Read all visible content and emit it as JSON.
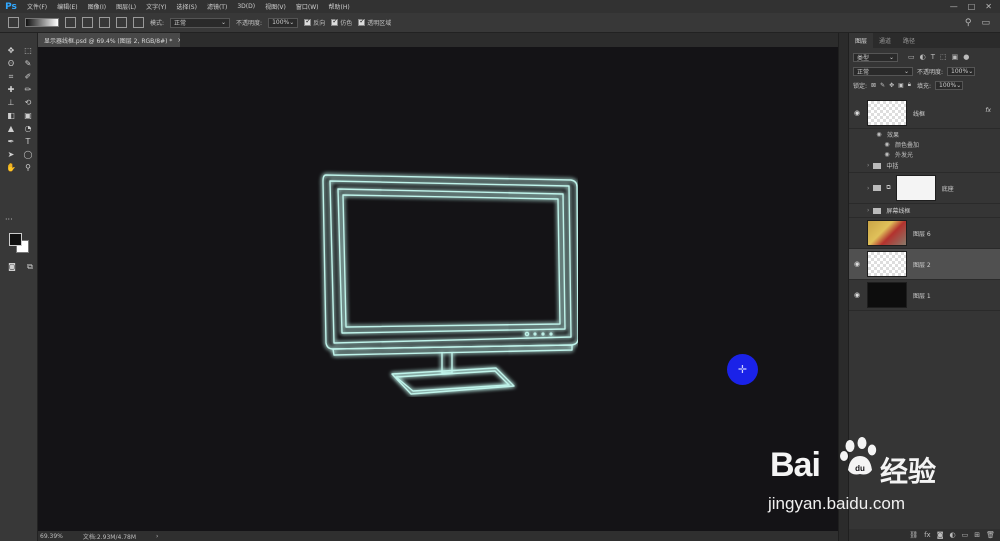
{
  "app": {
    "logo": "Ps",
    "menu": [
      "文件(F)",
      "编辑(E)",
      "图像(I)",
      "图层(L)",
      "文字(Y)",
      "选择(S)",
      "滤镜(T)",
      "3D(D)",
      "视图(V)",
      "窗口(W)",
      "帮助(H)"
    ],
    "window_controls": [
      "—",
      "□",
      "✕"
    ]
  },
  "options_bar": {
    "mode_label": "模式:",
    "mode_value": "正常",
    "opacity_label": "不透明度:",
    "opacity_value": "100%",
    "checkboxes": [
      "反向",
      "仿色",
      "透明区域"
    ]
  },
  "tools": {
    "icons": [
      "move-tool",
      "marquee-tool",
      "lasso-tool",
      "magic-wand-tool",
      "crop-tool",
      "eyedropper-tool",
      "healing-tool",
      "brush-tool",
      "stamp-tool",
      "history-brush-tool",
      "eraser-tool",
      "gradient-tool",
      "blur-tool",
      "dodge-tool",
      "pen-tool",
      "type-tool",
      "path-select-tool",
      "shape-tool",
      "hand-tool",
      "zoom-tool"
    ],
    "glyphs": [
      "✥",
      "⬚",
      "ʘ",
      "✎",
      "⌗",
      "✐",
      "✚",
      "✏",
      "⊥",
      "⟲",
      "◧",
      "▣",
      "▲",
      "◔",
      "✒",
      "T",
      "➤",
      "◯",
      "✋",
      "⚲"
    ],
    "extra": "···",
    "foreground_color": "#111111",
    "background_color": "#ffffff"
  },
  "document": {
    "tab_title": "显示器线框.psd @ 69.4% (图层 2, RGB/8#) *",
    "close": "×"
  },
  "status": {
    "zoom": "69.39%",
    "doc_info": "文档:2.93M/4.78M",
    "arrow": "›"
  },
  "layers_panel": {
    "tabs": [
      "图层",
      "通道",
      "路径"
    ],
    "filter_label": "类型",
    "blend_mode": "正常",
    "opacity_label": "不透明度:",
    "opacity_value": "100%",
    "lock_label": "锁定:",
    "fill_label": "填充:",
    "fill_value": "100%",
    "layers": [
      {
        "name": "线框",
        "thumb": "checker",
        "visible": true,
        "fx": "fx"
      },
      {
        "name": "中括",
        "type": "group"
      },
      {
        "name": "底座",
        "thumb": "white",
        "visible": false
      },
      {
        "name": "屏幕线框",
        "type": "group"
      },
      {
        "name": "图层 6",
        "thumb": "photo",
        "visible": false
      },
      {
        "name": "图层 2",
        "thumb": "checker",
        "visible": true,
        "selected": true
      },
      {
        "name": "图层 1",
        "thumb": "black",
        "visible": true
      }
    ],
    "effects_label": "效果",
    "effects": [
      "颜色叠加",
      "外发光"
    ]
  },
  "watermark": {
    "brand": "Bai",
    "suffix": "经验",
    "url": "jingyan.baidu.com"
  },
  "colors": {
    "glow": "#bff3ea",
    "cursor": "#1a22e8",
    "canvas": "#141316"
  }
}
